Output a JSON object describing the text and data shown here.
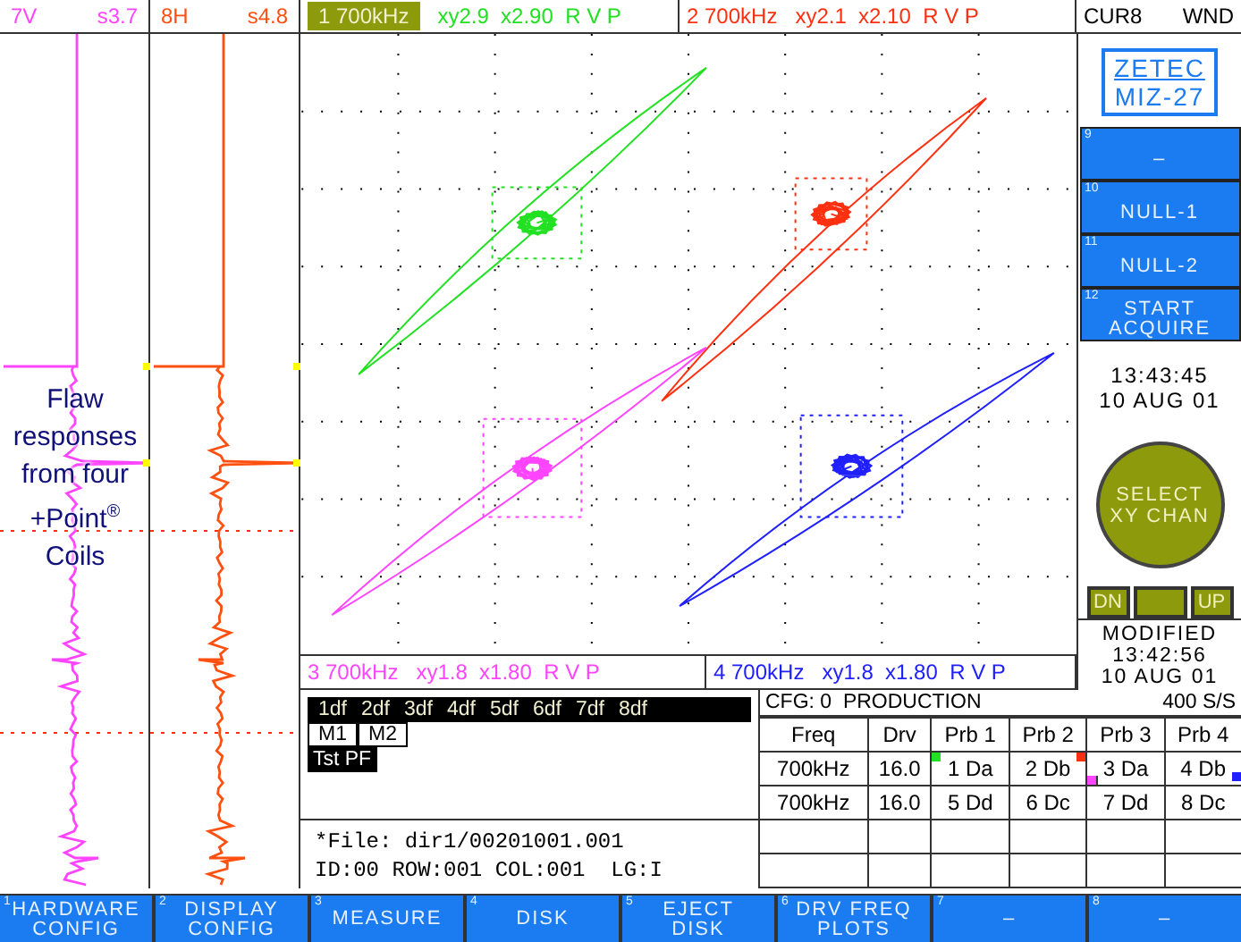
{
  "strip_charts": [
    {
      "channel": "7V",
      "scale": "s3.7",
      "color": "#ff44ff"
    },
    {
      "channel": "8H",
      "scale": "s4.8",
      "color": "#ff5010"
    }
  ],
  "xy_channels": [
    {
      "label": "1 700kHz",
      "settings": "xy2.9  x2.90  R V P",
      "color": "#22e022",
      "selected": true
    },
    {
      "label": "2 700kHz",
      "settings": "xy2.1  x2.10  R V P",
      "color": "#ff3010",
      "selected": false
    },
    {
      "label": "3 700kHz",
      "settings": "xy1.8  x1.80  R V P",
      "color": "#ff44ff",
      "selected": false
    },
    {
      "label": "4 700kHz",
      "settings": "xy1.8  x1.80  R V P",
      "color": "#2020ff",
      "selected": false
    }
  ],
  "cursor": {
    "label": "CUR8",
    "mode": "WND"
  },
  "logo": {
    "brand": "ZETEC",
    "model": "MIZ-27"
  },
  "soft_keys": [
    {
      "number": "9",
      "label": "–"
    },
    {
      "number": "10",
      "label": "NULL-1"
    },
    {
      "number": "11",
      "label": "NULL-2"
    },
    {
      "number": "12",
      "label": "START\nACQUIRE"
    }
  ],
  "clock": {
    "time": "13:43:45",
    "date": "10 AUG 01"
  },
  "select_button": {
    "label": "SELECT\nXY CHAN"
  },
  "nav": {
    "down": "DN",
    "up": "UP"
  },
  "modified": {
    "label": "MODIFIED",
    "time": "13:42:56",
    "date": "10 AUG 01"
  },
  "annotation": "Flaw responses from four +Point$^{®}$ Coils",
  "df_tabs": [
    "1df",
    "2df",
    "3df",
    "4df",
    "5df",
    "6df",
    "7df",
    "8df"
  ],
  "mix_tabs": [
    "M1",
    "M2"
  ],
  "test_tab": "Tst PF",
  "file": {
    "name": "*File: dir1/00201001.001",
    "status": "ID:00 ROW:001 COL:001  LG:I"
  },
  "config": {
    "title": "CFG: 0  PRODUCTION",
    "rate": "400 S/S",
    "columns": [
      "Freq",
      "Drv",
      "Prb 1",
      "Prb 2",
      "Prb 3",
      "Prb 4"
    ],
    "rows": [
      [
        "700kHz",
        "16.0",
        "1 Da",
        "2 Db",
        "3 Da",
        "4 Db"
      ],
      [
        "700kHz",
        "16.0",
        "5 Dd",
        "6 Dc",
        "7 Dd",
        "8 Dc"
      ]
    ]
  },
  "function_keys": [
    {
      "number": "1",
      "label": "HARDWARE\nCONFIG"
    },
    {
      "number": "2",
      "label": "DISPLAY\nCONFIG"
    },
    {
      "number": "3",
      "label": "MEASURE"
    },
    {
      "number": "4",
      "label": "DISK"
    },
    {
      "number": "5",
      "label": "EJECT\nDISK"
    },
    {
      "number": "6",
      "label": "DRV FREQ\nPLOTS"
    },
    {
      "number": "7",
      "label": "–"
    },
    {
      "number": "8",
      "label": "–"
    }
  ]
}
